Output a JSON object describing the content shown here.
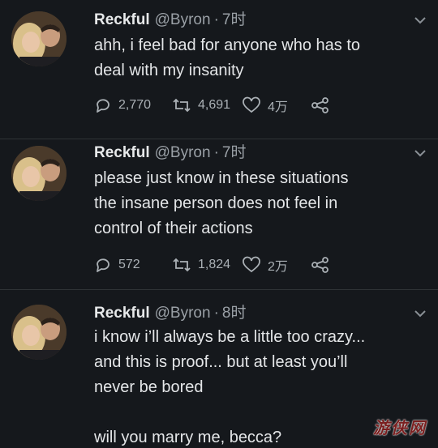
{
  "tweets": [
    {
      "name": "Reckful",
      "handle": "@Byron",
      "time": "7时",
      "lines": [
        "ahh, i feel bad for anyone who has to",
        "deal with my insanity"
      ],
      "replies": "2,770",
      "retweets": "4,691",
      "likes": "4万"
    },
    {
      "name": "Reckful",
      "handle": "@Byron",
      "time": "7时",
      "lines": [
        "please just know in these situations",
        "the insane person does not feel in",
        "control of their actions"
      ],
      "replies": "572",
      "retweets": "1,824",
      "likes": "2万"
    },
    {
      "name": "Reckful",
      "handle": "@Byron",
      "time": "8时",
      "lines": [
        "i know i’ll always be a little too crazy...",
        "and this is proof... but at least you’ll",
        "never be bored",
        "will you marry me, becca?"
      ]
    }
  ],
  "separator": "·",
  "watermark": "游侠网",
  "icons": [
    "reply-icon",
    "retweet-icon",
    "like-icon",
    "share-icon",
    "chevron-down-icon"
  ],
  "colors": {
    "background": "#15181c",
    "text": "#e4e6e8",
    "muted": "#9aa0a6",
    "divider": "#2f3336"
  }
}
